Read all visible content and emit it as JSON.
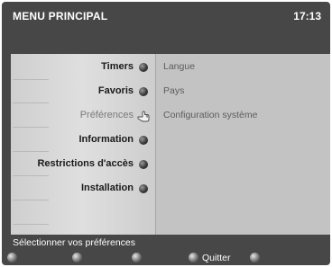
{
  "header": {
    "title": "MENU PRINCIPAL",
    "time": "17:13"
  },
  "menu": {
    "items": [
      {
        "label": "Timers"
      },
      {
        "label": "Favoris"
      },
      {
        "label": "Préférences",
        "selected": true
      },
      {
        "label": "Information"
      },
      {
        "label": "Restrictions d'accès"
      },
      {
        "label": "Installation"
      }
    ]
  },
  "submenu": {
    "items": [
      {
        "label": "Langue"
      },
      {
        "label": "Pays"
      },
      {
        "label": "Configuration système"
      }
    ]
  },
  "footer": {
    "hint": "Sélectionner vos préférences",
    "quit_label": "Quitter"
  },
  "colors": {
    "screen_bg": "#474747",
    "panel_left": "#dcdcdc",
    "panel_right": "#c3c3c3"
  }
}
